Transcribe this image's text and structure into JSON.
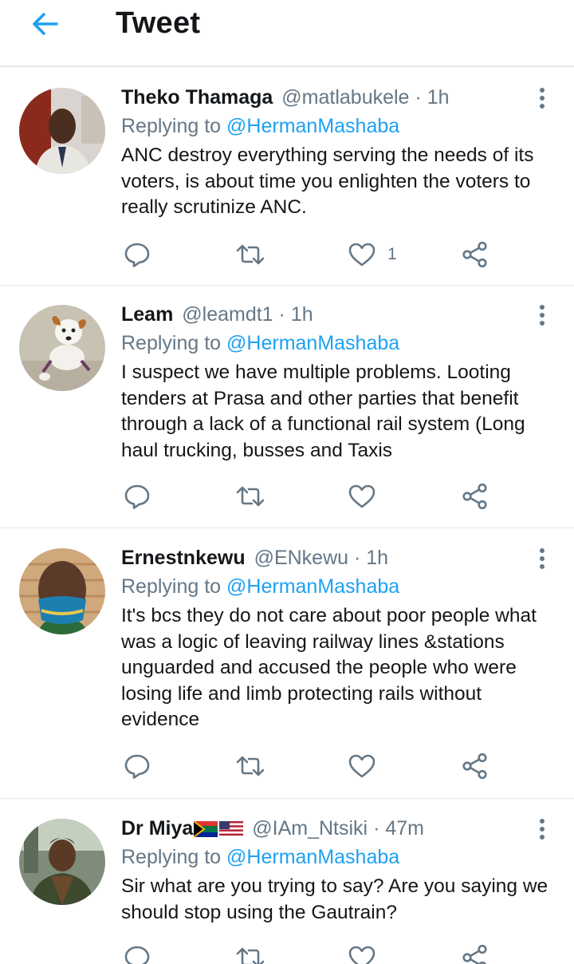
{
  "header": {
    "title": "Tweet",
    "back_icon": "arrow-left-icon",
    "accent": "#1da1f2"
  },
  "tweets": [
    {
      "name": "Theko Thamaga",
      "handle": "@matlabukele",
      "dot": "·",
      "time": "1h",
      "replying_prefix": "Replying to ",
      "replying_to": "@HermanMashaba",
      "text": "ANC destroy everything serving the needs of its voters, is about time you enlighten the voters to really scrutinize ANC.",
      "likes": "1"
    },
    {
      "name": "Leam",
      "handle": "@leamdt1",
      "dot": "·",
      "time": "1h",
      "replying_prefix": "Replying to ",
      "replying_to": "@HermanMashaba",
      "text": "I suspect we have multiple problems. Looting tenders at Prasa and other parties that benefit through a lack of a functional rail system (Long haul trucking, busses and Taxis",
      "likes": ""
    },
    {
      "name": "Ernestnkewu",
      "handle": "@ENkewu",
      "dot": "·",
      "time": "1h",
      "replying_prefix": "Replying to ",
      "replying_to": "@HermanMashaba",
      "text": "It's bcs they do not care about poor people what was a logic of leaving railway lines &stations unguarded and accused the people who were losing life and limb protecting rails without evidence",
      "likes": ""
    },
    {
      "name": "Dr Miya",
      "handle": "@IAm_Ntsiki",
      "dot": "·",
      "time": "47m",
      "replying_prefix": "Replying to ",
      "replying_to": "@HermanMashaba",
      "text": "Sir what are you trying to say? Are you saying we should stop using the Gautrain?",
      "likes": ""
    }
  ],
  "icons": {
    "reply": "reply-bubble-icon",
    "retweet": "retweet-icon",
    "like": "heart-icon",
    "share": "share-icon",
    "more": "more-vertical-icon"
  },
  "colors": {
    "text": "#14171a",
    "secondary": "#657786",
    "link": "#1da1f2",
    "divider": "#e1e8ed"
  }
}
